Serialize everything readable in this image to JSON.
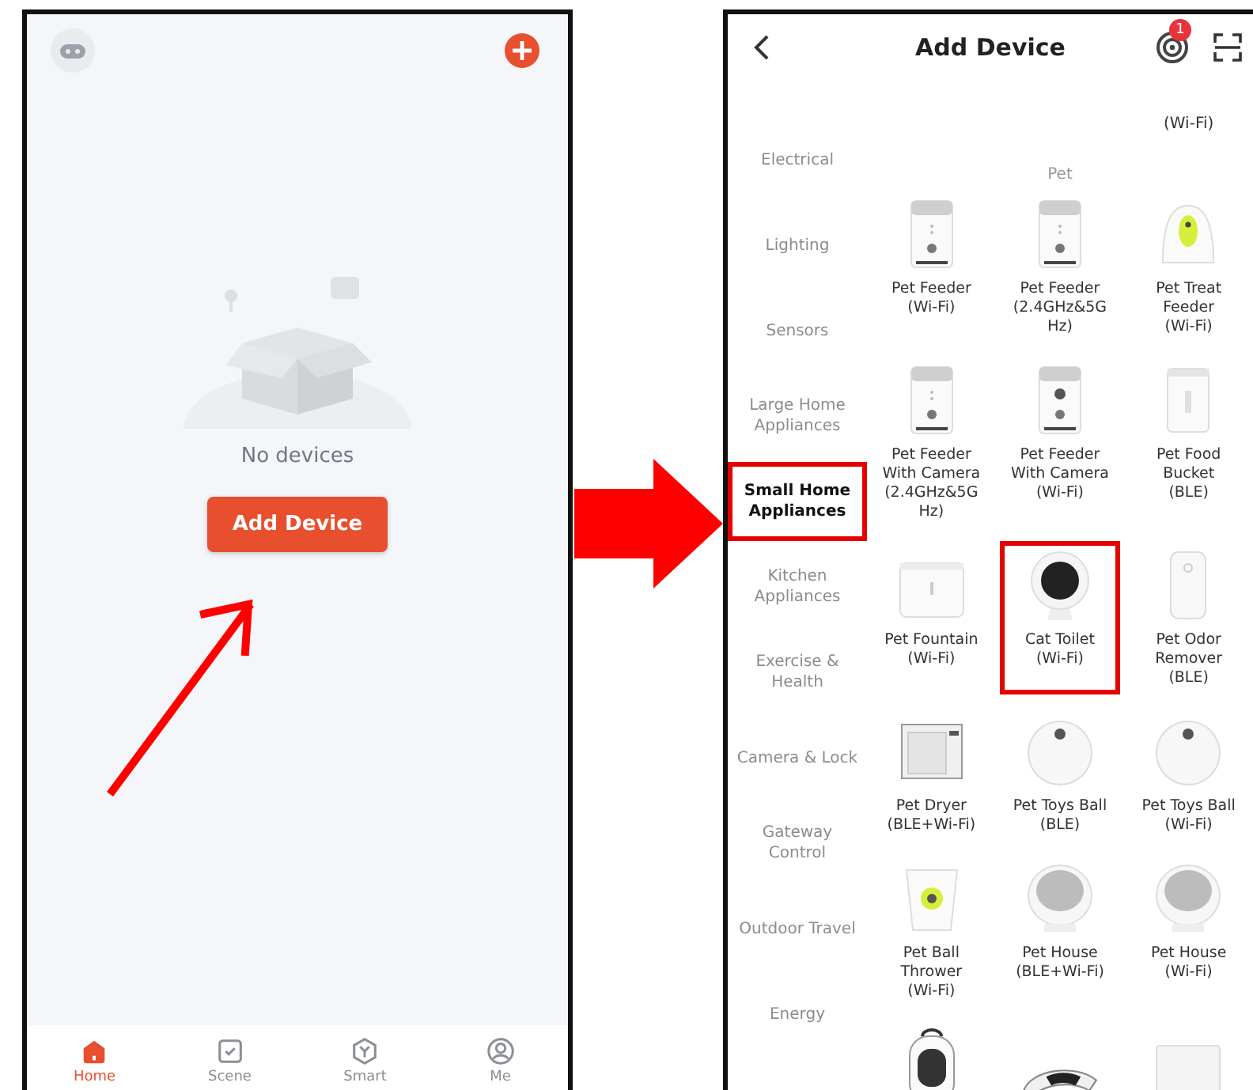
{
  "home_screen": {
    "empty_state": {
      "message": "No devices",
      "button": "Add Device"
    },
    "tabs": [
      {
        "label": "Home",
        "kind": "home",
        "selected": true
      },
      {
        "label": "Scene",
        "kind": "scene",
        "selected": false
      },
      {
        "label": "Smart",
        "kind": "smart",
        "selected": false
      },
      {
        "label": "Me",
        "kind": "me",
        "selected": false
      }
    ]
  },
  "add_device_screen": {
    "title": "Add Device",
    "notification_badge": "1",
    "categories": [
      {
        "label": "Electrical",
        "selected": false,
        "highlighted": false
      },
      {
        "label": "Lighting",
        "selected": false,
        "highlighted": false
      },
      {
        "label": "Sensors",
        "selected": false,
        "highlighted": false
      },
      {
        "label": "Large Home\nAppliances",
        "selected": false,
        "highlighted": false
      },
      {
        "label": "Small Home\nAppliances",
        "selected": true,
        "highlighted": true
      },
      {
        "label": "Kitchen\nAppliances",
        "selected": false,
        "highlighted": false
      },
      {
        "label": "Exercise &\nHealth",
        "selected": false,
        "highlighted": false
      },
      {
        "label": "Camera & Lock",
        "selected": false,
        "highlighted": false
      },
      {
        "label": "Gateway\nControl",
        "selected": false,
        "highlighted": false
      },
      {
        "label": "Outdoor Travel",
        "selected": false,
        "highlighted": false
      },
      {
        "label": "Energy",
        "selected": false,
        "highlighted": false
      }
    ],
    "cut_off_label": "(Wi-Fi)",
    "section_title": "Pet",
    "devices": [
      {
        "label": "Pet Feeder\n(Wi-Fi)",
        "kind": "feeder",
        "highlighted": false
      },
      {
        "label": "Pet Feeder\n(2.4GHz&5G\nHz)",
        "kind": "feeder",
        "highlighted": false
      },
      {
        "label": "Pet Treat\nFeeder\n(Wi-Fi)",
        "kind": "treat",
        "highlighted": false
      },
      {
        "label": "Pet Feeder\nWith Camera\n(2.4GHz&5G\nHz)",
        "kind": "feeder",
        "highlighted": false
      },
      {
        "label": "Pet Feeder\nWith Camera\n(Wi-Fi)",
        "kind": "camfeeder",
        "highlighted": false
      },
      {
        "label": "Pet Food\nBucket\n(BLE)",
        "kind": "bucket",
        "highlighted": false
      },
      {
        "label": "Pet Fountain\n(Wi-Fi)",
        "kind": "fountain",
        "highlighted": false
      },
      {
        "label": "Cat Toilet\n(Wi-Fi)",
        "kind": "toilet",
        "highlighted": true
      },
      {
        "label": "Pet Odor\nRemover\n(BLE)",
        "kind": "odor",
        "highlighted": false
      },
      {
        "label": "Pet Dryer\n(BLE+Wi-Fi)",
        "kind": "dryer",
        "highlighted": false
      },
      {
        "label": "Pet Toys Ball\n(BLE)",
        "kind": "ball",
        "highlighted": false
      },
      {
        "label": "Pet Toys Ball\n(Wi-Fi)",
        "kind": "ball",
        "highlighted": false
      },
      {
        "label": "Pet Ball\nThrower\n(Wi-Fi)",
        "kind": "thrower",
        "highlighted": false
      },
      {
        "label": "Pet House\n(BLE+Wi-Fi)",
        "kind": "house",
        "highlighted": false
      },
      {
        "label": "Pet House\n(Wi-Fi)",
        "kind": "house",
        "highlighted": false
      },
      {
        "kind": "backpack",
        "highlighted": false
      },
      {
        "kind": "leash",
        "highlighted": false
      },
      {
        "kind": "mat",
        "highlighted": false
      }
    ]
  }
}
